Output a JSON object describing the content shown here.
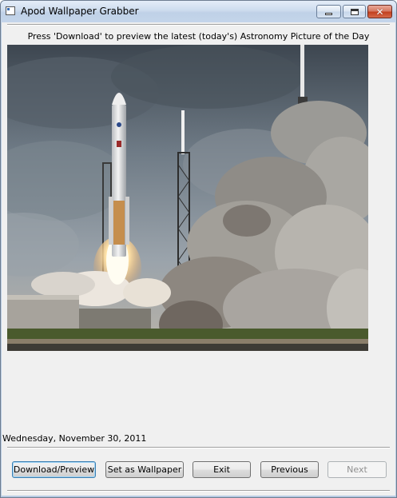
{
  "window": {
    "title": "Apod Wallpaper Grabber",
    "controls": [
      "minimize-icon",
      "maximize-icon",
      "close-icon"
    ]
  },
  "main": {
    "instruction": "Press 'Download' to preview the latest (today's) Astronomy Picture of the Day",
    "image_subject": "rocket launch on pad with smoke plume",
    "date": "Wednesday, November 30, 2011"
  },
  "buttons": {
    "download": "Download/Preview",
    "set_wallpaper": "Set as Wallpaper",
    "exit": "Exit",
    "previous": "Previous",
    "next": "Next"
  },
  "colors": {
    "title_bar": "#c4d5ea",
    "client_bg": "#f0f0f0",
    "close_button": "#c2401f",
    "focus_border": "#3c7fb1"
  }
}
